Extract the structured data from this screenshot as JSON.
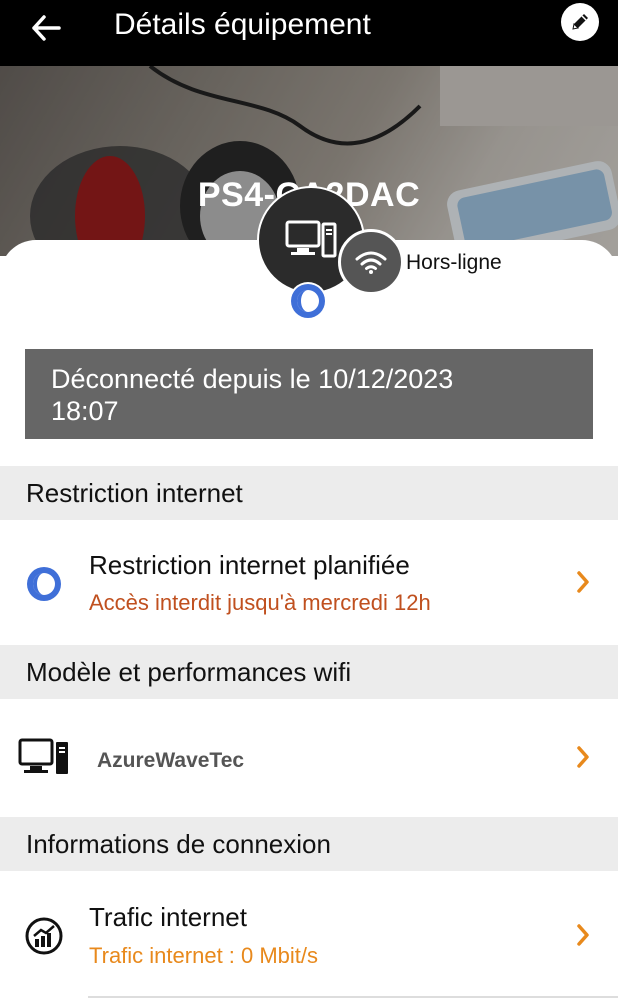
{
  "header": {
    "title": "Détails équipement",
    "back_icon": "arrow-left-icon",
    "edit_icon": "pencil-icon"
  },
  "device": {
    "name": "PS4-CA2DAC",
    "icon": "desktop-computer-icon",
    "connection_icon": "wifi-icon",
    "status": "Hors-ligne"
  },
  "disconnected_banner": {
    "line1": "Déconnecté depuis le 10/12/2023",
    "line2": "18:07"
  },
  "sections": {
    "restriction": {
      "header": "Restriction internet",
      "item_title": "Restriction internet planifiée",
      "item_subtitle": "Accès interdit jusqu'à mercredi 12h",
      "subtitle_color": "#c0501f",
      "icon": "clock-schedule-icon"
    },
    "model": {
      "header": "Modèle et performances wifi",
      "item_title": "AzureWaveTec",
      "icon": "desktop-computer-icon"
    },
    "connection": {
      "header": "Informations de connexion",
      "item_title": "Trafic internet",
      "item_subtitle": "Trafic internet : 0 Mbit/s",
      "subtitle_color": "#e8891c",
      "icon": "traffic-chart-icon"
    }
  },
  "colors": {
    "accent": "#e8891c",
    "schedule_blue": "#3f6fd8",
    "banner": "#666666"
  }
}
